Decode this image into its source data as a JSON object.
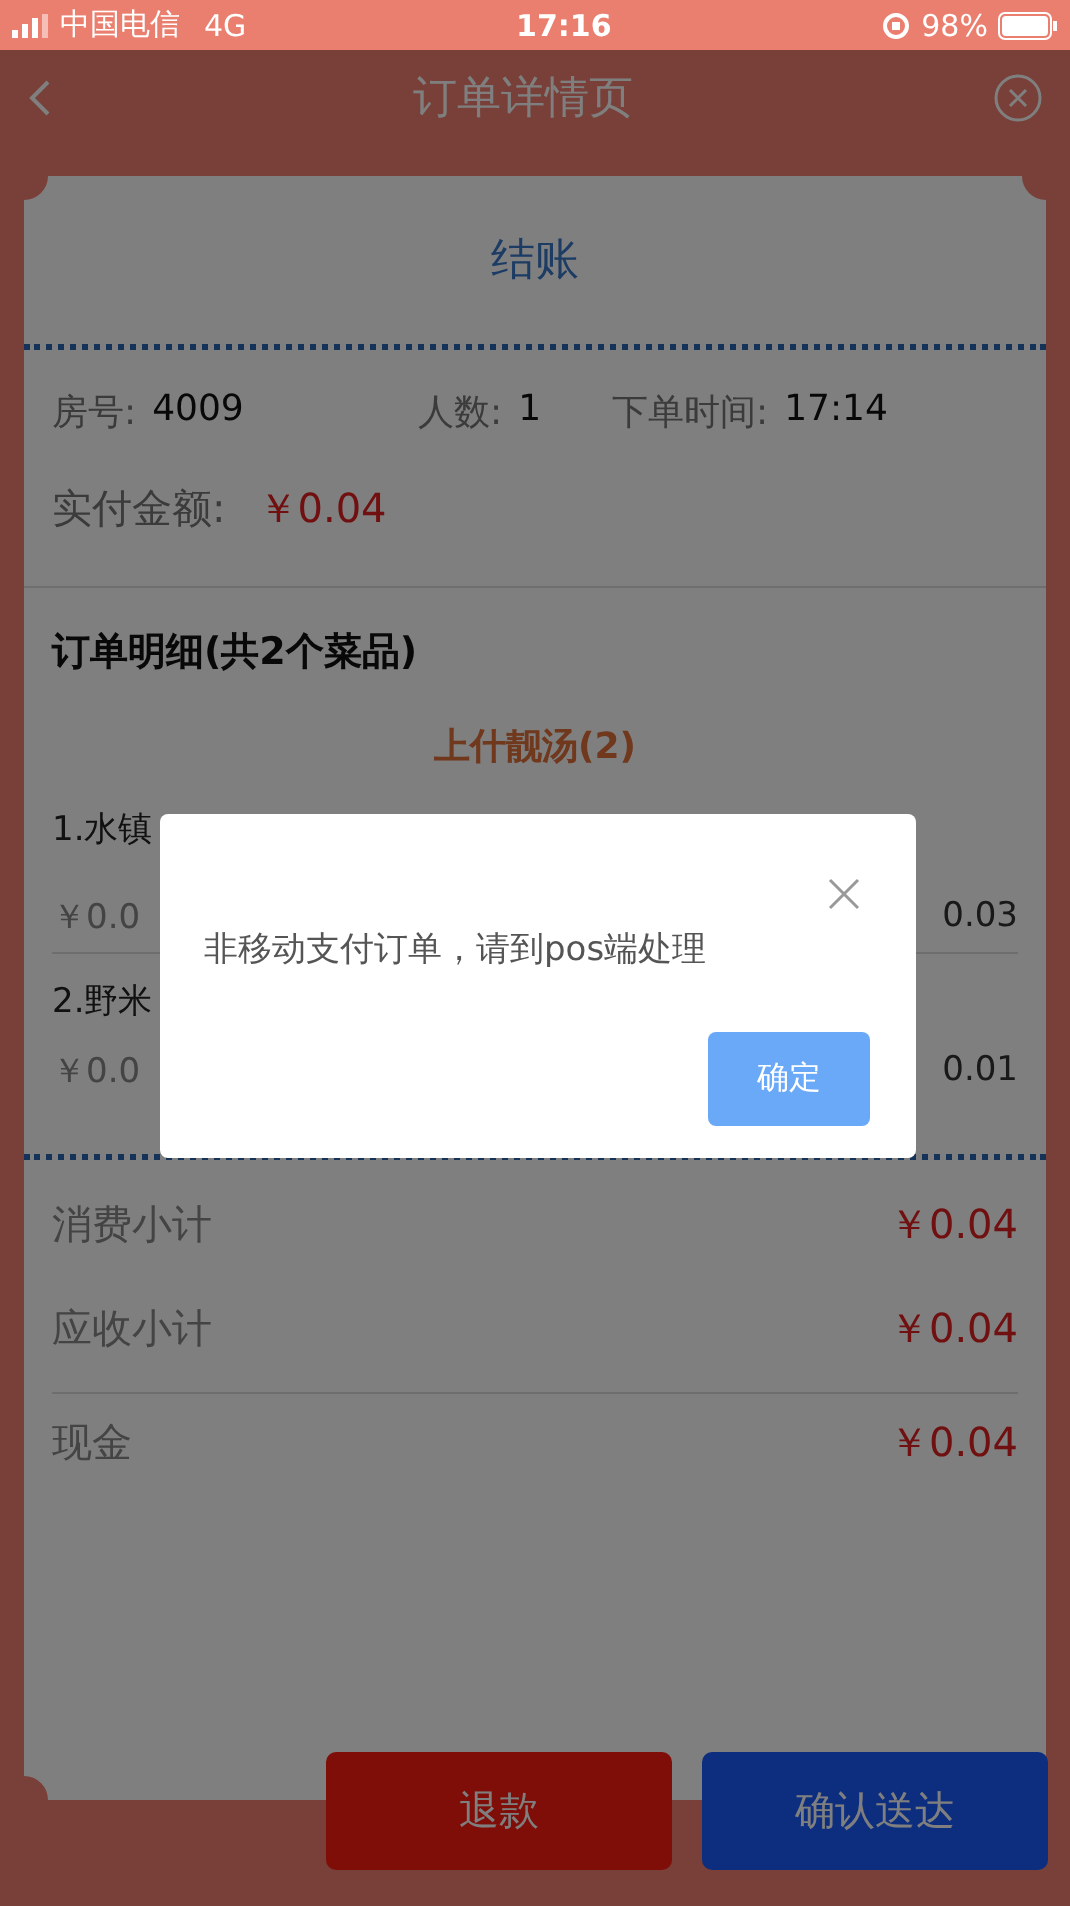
{
  "status_bar": {
    "carrier": "中国电信",
    "network": "4G",
    "time": "17:16",
    "battery": "98%"
  },
  "header": {
    "title": "订单详情页"
  },
  "card": {
    "title": "结账",
    "info": [
      {
        "label": "房号:",
        "value": "4009"
      },
      {
        "label": "人数:",
        "value": "1"
      },
      {
        "label": "下单时间:",
        "value": "17:14"
      }
    ],
    "paid": {
      "label": "实付金额:",
      "value": "￥0.04"
    },
    "details_title": "订单明细(共2个菜品)",
    "group": "上什靓汤(2)",
    "items": [
      {
        "name": "1.水镇",
        "price": "￥0.0",
        "total": "0.03"
      },
      {
        "name": "2.野米",
        "price": "￥0.0",
        "total": "0.01"
      }
    ],
    "summary": [
      {
        "label": "消费小计",
        "value": "￥0.04",
        "divider": false
      },
      {
        "label": "应收小计",
        "value": "￥0.04",
        "divider": true
      },
      {
        "label": "现金",
        "value": "￥0.04",
        "divider": false
      }
    ]
  },
  "buttons": [
    {
      "label": "退款",
      "kind": "refund"
    },
    {
      "label": "确认送达",
      "kind": "confirm"
    }
  ],
  "dialog": {
    "message": "非移动支付订单，请到pos端处理",
    "button": "确定"
  }
}
